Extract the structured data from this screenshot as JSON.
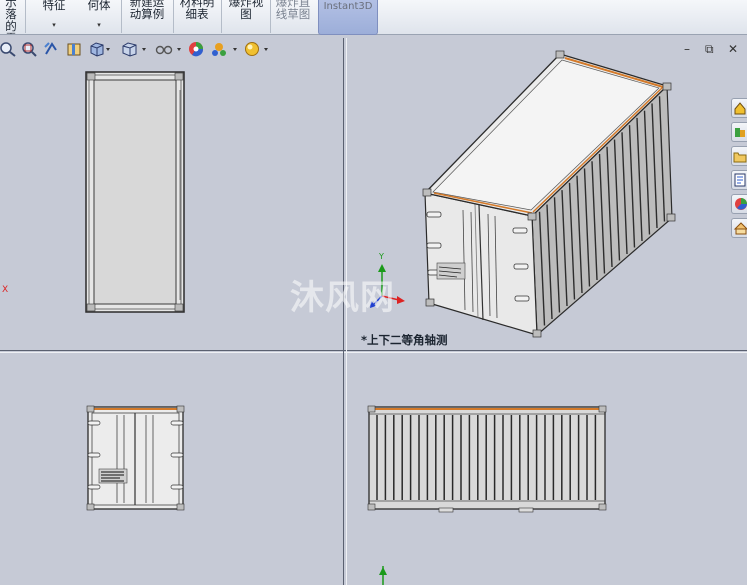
{
  "ribbon": {
    "buttons": [
      {
        "line1": "示落",
        "line2": "的零",
        "line3": "部件",
        "arrow": ""
      },
      {
        "line1": "特征",
        "line2": "",
        "line3": "",
        "arrow": "▾"
      },
      {
        "line1": "何体",
        "line2": "",
        "line3": "",
        "arrow": "▾"
      },
      {
        "line1": "新建运",
        "line2": "动算例",
        "line3": "",
        "arrow": ""
      },
      {
        "line1": "材料明",
        "line2": "细表",
        "line3": "",
        "arrow": ""
      },
      {
        "line1": "爆炸视",
        "line2": "图",
        "line3": "",
        "arrow": ""
      },
      {
        "line1": "爆炸直",
        "line2": "线草图",
        "line3": "",
        "arrow": ""
      }
    ],
    "instant3d": "Instant3D"
  },
  "view_toolbar": {
    "icons": [
      "zoom-to-fit-icon",
      "zoom-to-area-icon",
      "previous-view-icon",
      "section-view-icon",
      "view-orientation-icon",
      "display-style-icon",
      "hide-show-items-icon",
      "edit-appearance-icon",
      "apply-scene-icon",
      "view-settings-icon"
    ]
  },
  "window_controls": {
    "minimize": "–",
    "restore": "⧉",
    "close": "✕"
  },
  "task_pane": {
    "icons": [
      "solidworks-resources-icon",
      "design-library-icon",
      "file-explorer-icon",
      "view-palette-icon",
      "appearances-scenes-icon",
      "custom-properties-icon"
    ]
  },
  "viewports": {
    "iso_label": "*上下二等角轴测",
    "watermark": "沐风网",
    "axis_x": "X",
    "axis_y": "Y"
  },
  "colors": {
    "viewport_bg": "#c6cad6",
    "model_edge": "#2b2b2b",
    "model_top_trim": "#d47a2a",
    "ribbon_bg": "#e6eaf1",
    "instant3d_bg": "#a9b8e0"
  }
}
